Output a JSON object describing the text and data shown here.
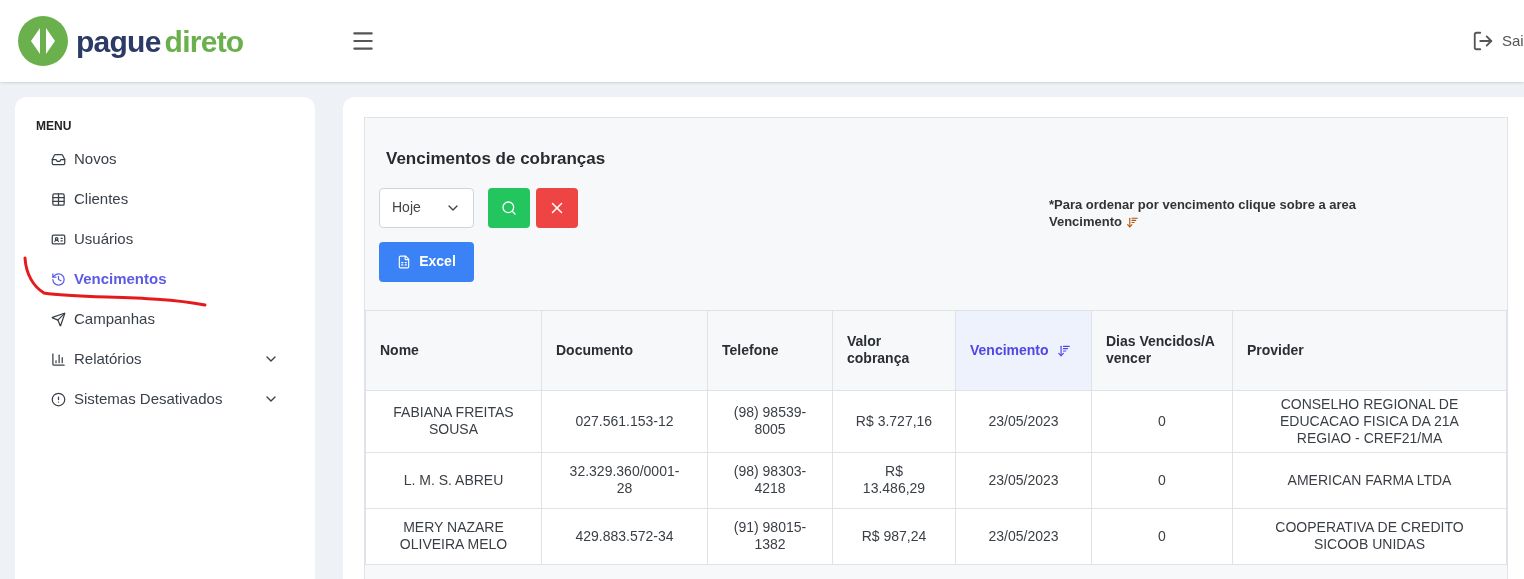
{
  "header": {
    "logo": {
      "part_1": "pague",
      "part_2": "direto"
    },
    "logout": "Sai"
  },
  "sidebar": {
    "heading": "MENU",
    "items": [
      {
        "label": "Novos",
        "kind": "link",
        "selected": false
      },
      {
        "label": "Clientes",
        "kind": "link",
        "selected": false
      },
      {
        "label": "Usuários",
        "kind": "link",
        "selected": false
      },
      {
        "label": "Vencimentos",
        "kind": "link",
        "selected": true
      },
      {
        "label": "Campanhas",
        "kind": "link",
        "selected": false
      },
      {
        "label": "Relatórios",
        "kind": "dropdown",
        "selected": false
      },
      {
        "label": "Sistemas Desativados",
        "kind": "dropdown",
        "selected": false
      }
    ]
  },
  "page": {
    "title": "Vencimentos de cobranças",
    "period_select": {
      "value": "Hoje"
    },
    "excel_button": "Excel",
    "hint": {
      "text": "*Para ordenar por vencimento clique sobre a area Vencimento"
    }
  },
  "table": {
    "columns": [
      {
        "label": "Nome",
        "sorted": false
      },
      {
        "label": "Documento",
        "sorted": false
      },
      {
        "label": "Telefone",
        "sorted": false
      },
      {
        "label": "Valor cobrança",
        "sorted": false
      },
      {
        "label": "Vencimento",
        "sorted": true
      },
      {
        "label": "Dias Vencidos/A vencer",
        "sorted": false
      },
      {
        "label": "Provider",
        "sorted": false
      }
    ],
    "rows": [
      [
        "FABIANA FREITAS SOUSA",
        "027.561.153-12",
        "(98) 98539-8005",
        "R$ 3.727,16",
        "23/05/2023",
        "0",
        "CONSELHO REGIONAL DE EDUCACAO FISICA DA 21A REGIAO - CREF21/MA"
      ],
      [
        "L. M. S. ABREU",
        "32.329.360/0001-28",
        "(98) 98303-4218",
        "R$ 13.486,29",
        "23/05/2023",
        "0",
        "AMERICAN FARMA LTDA"
      ],
      [
        "MERY NAZARE OLIVEIRA MELO",
        "429.883.572-34",
        "(91) 98015-1382",
        "R$ 987,24",
        "23/05/2023",
        "0",
        "COOPERATIVA DE CREDITO SICOOB UNIDAS"
      ]
    ]
  }
}
